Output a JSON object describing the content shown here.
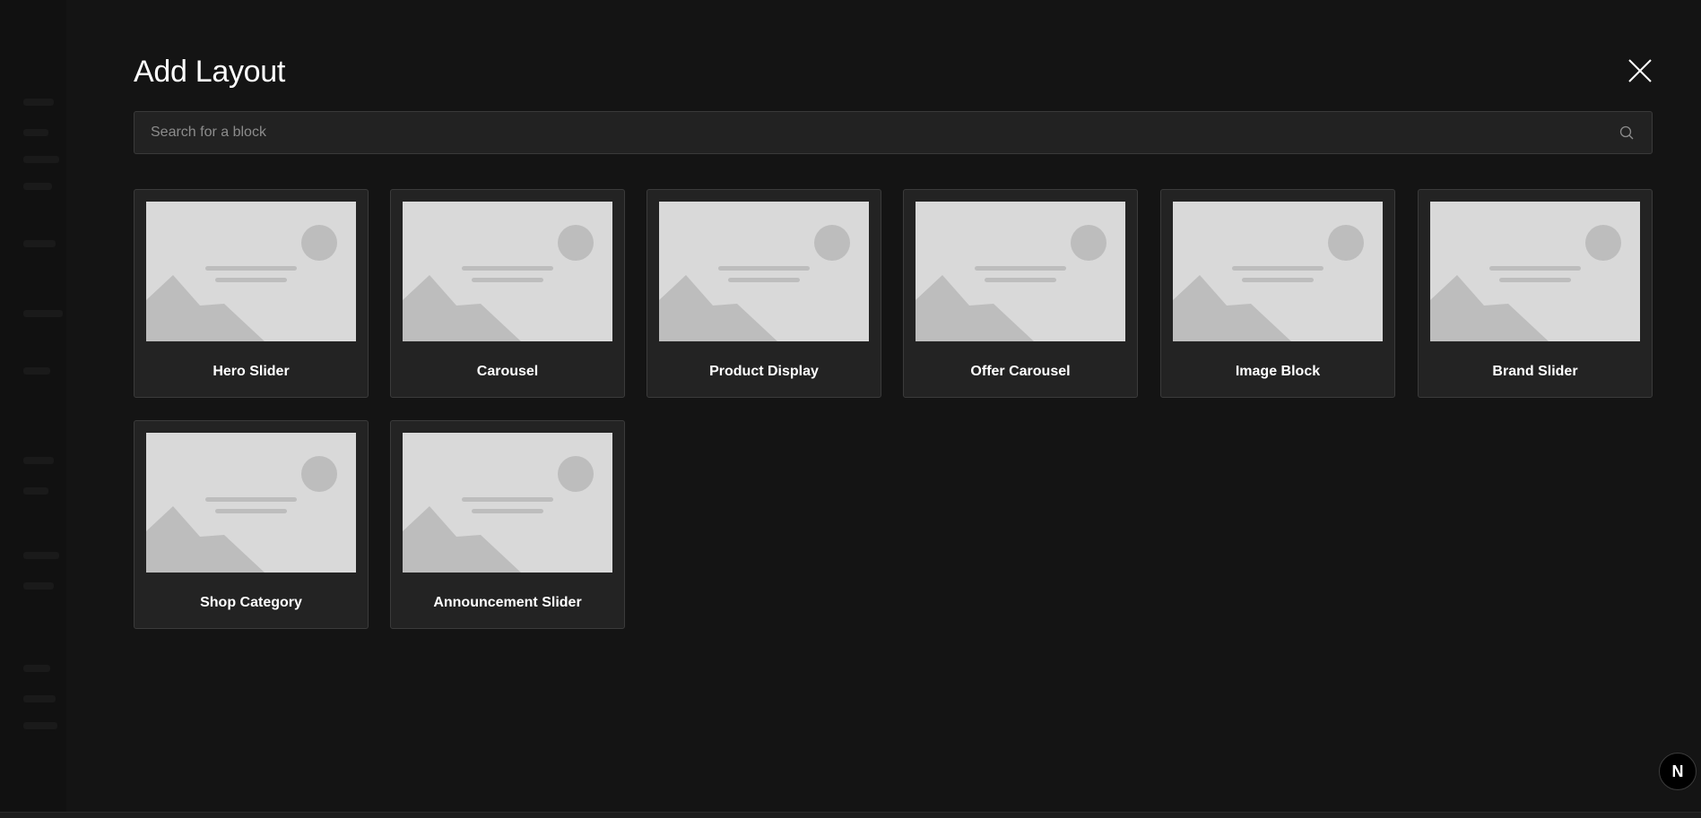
{
  "modal": {
    "title": "Add Layout",
    "close_icon": "close-icon"
  },
  "search": {
    "placeholder": "Search for a block",
    "value": "",
    "icon": "search-icon"
  },
  "blocks": [
    {
      "label": "Hero Slider"
    },
    {
      "label": "Carousel"
    },
    {
      "label": "Product Display"
    },
    {
      "label": "Offer Carousel"
    },
    {
      "label": "Image Block"
    },
    {
      "label": "Brand Slider"
    },
    {
      "label": "Shop Category"
    },
    {
      "label": "Announcement Slider"
    }
  ],
  "dev_badge": {
    "text": "N",
    "icon": "nextjs-icon"
  },
  "colors": {
    "background": "#141414",
    "card": "#232323",
    "card_border": "#3b3b3b",
    "thumb_bg": "#d9d9d9",
    "thumb_shape": "#bdbdbd"
  }
}
